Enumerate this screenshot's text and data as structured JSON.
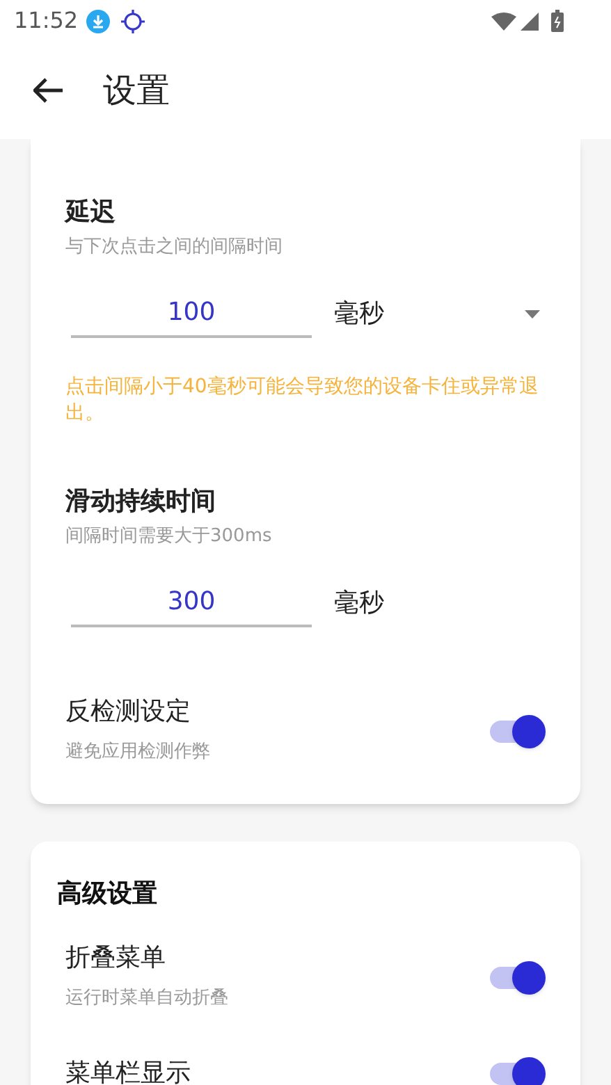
{
  "status_bar": {
    "time": "11:52"
  },
  "app_bar": {
    "title": "设置"
  },
  "sections": [
    {
      "items": [
        {
          "kind": "number",
          "title": "延迟",
          "subtitle": "与下次点击之间的间隔时间",
          "value": "100",
          "unit": "毫秒",
          "dropdown": true,
          "warning": "点击间隔小于40毫秒可能会导致您的设备卡住或异常退出。"
        },
        {
          "kind": "number",
          "title": "滑动持续时间",
          "subtitle": "间隔时间需要大于300ms",
          "value": "300",
          "unit": "毫秒",
          "dropdown": false
        },
        {
          "kind": "switch",
          "title": "反检测设定",
          "subtitle": "避免应用检测作弊",
          "on": true
        }
      ]
    },
    {
      "header": "高级设置",
      "items": [
        {
          "kind": "switch",
          "title": "折叠菜单",
          "subtitle": "运行时菜单自动折叠",
          "on": true
        },
        {
          "kind": "switch",
          "title": "菜单栏显示",
          "on": true
        }
      ]
    }
  ]
}
